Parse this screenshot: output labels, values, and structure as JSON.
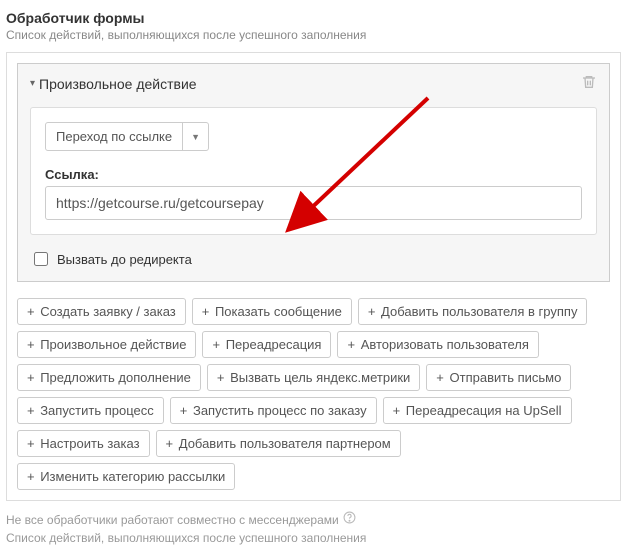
{
  "header": {
    "title": "Обработчик формы",
    "subtitle": "Список действий, выполняющихся после успешного заполнения"
  },
  "action": {
    "title": "Произвольное действие",
    "select_label": "Переход по ссылке",
    "link_label": "Ссылка:",
    "link_value": "https://getcourse.ru/getcoursepay",
    "checkbox_label": "Вызвать до редиректа"
  },
  "buttons": [
    "Создать заявку / заказ",
    "Показать сообщение",
    "Добавить пользователя в группу",
    "Произвольное действие",
    "Переадресация",
    "Авторизовать пользователя",
    "Предложить дополнение",
    "Вызвать цель яндекс.метрики",
    "Отправить письмо",
    "Запустить процесс",
    "Запустить процесс по заказу",
    "Переадресация на UpSell",
    "Настроить заказ",
    "Добавить пользователя партнером",
    "Изменить категорию рассылки"
  ],
  "footer": {
    "note1": "Не все обработчики работают совместно с мессенджерами",
    "note2": "Список действий, выполняющихся после успешного заполнения"
  }
}
